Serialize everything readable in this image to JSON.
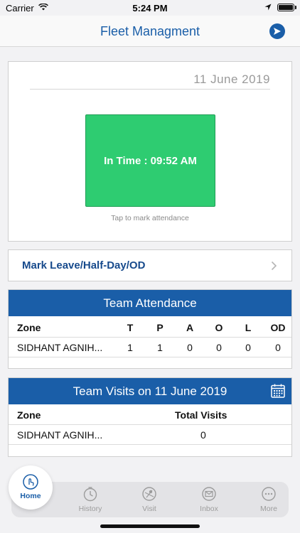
{
  "status_bar": {
    "carrier": "Carrier",
    "time": "5:24 PM"
  },
  "nav": {
    "title": "Fleet Managment",
    "send_icon": "send-arrow-icon"
  },
  "attendance": {
    "date": "11 June 2019",
    "in_time_label": "In Time : 09:52 AM",
    "hint": "Tap to mark attendance",
    "button_color": "#2ecc71"
  },
  "leave": {
    "label": "Mark Leave/Half-Day/OD"
  },
  "team_attendance": {
    "title": "Team Attendance",
    "columns": [
      "Zone",
      "T",
      "P",
      "A",
      "O",
      "L",
      "OD"
    ],
    "rows": [
      {
        "zone": "SIDHANT AGNIH...",
        "T": "1",
        "P": "1",
        "A": "0",
        "O": "0",
        "L": "0",
        "OD": "0"
      }
    ]
  },
  "team_visits": {
    "title": "Team Visits on 11 June 2019",
    "columns": [
      "Zone",
      "Total Visits"
    ],
    "rows": [
      {
        "zone": "SIDHANT AGNIH...",
        "visits": "0"
      }
    ]
  },
  "tabs": {
    "home": "Home",
    "history": "History",
    "visit": "Visit",
    "inbox": "Inbox",
    "more": "More"
  },
  "colors": {
    "accent": "#1a5ea8",
    "green": "#2ecc71"
  }
}
